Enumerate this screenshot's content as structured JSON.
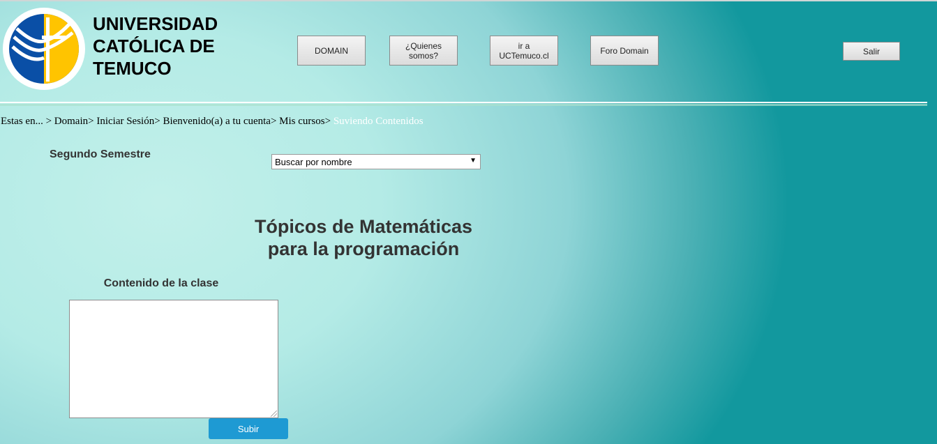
{
  "header": {
    "brand_lines": [
      "UNIVERSIDAD",
      "CATÓLICA DE",
      "TEMUCO"
    ],
    "nav": [
      {
        "label": "DOMAIN"
      },
      {
        "label": "¿Quienes somos?"
      },
      {
        "label": "ir a UCTemuco.cl"
      },
      {
        "label": "Foro Domain"
      }
    ],
    "exit_label": "Salir"
  },
  "breadcrumb": {
    "prefix": "Estas en... > ",
    "items": [
      "Domain>",
      "Iniciar Sesión>",
      "Bienvenido(a) a tu cuenta>",
      "Mis cursos>"
    ],
    "current": "Suviendo Contenidos"
  },
  "filters": {
    "semester_label": "Segundo Semestre",
    "search_select_value": "Buscar por nombre"
  },
  "main": {
    "title_line1": "Tópicos de Matemáticas",
    "title_line2": "para la programación",
    "content_label": "Contenido de la clase",
    "submit_label": "Subir"
  },
  "colors": {
    "logo_blue": "#0a4fa6",
    "logo_yellow": "#ffc400",
    "submit_blue": "#1e9ad3"
  }
}
